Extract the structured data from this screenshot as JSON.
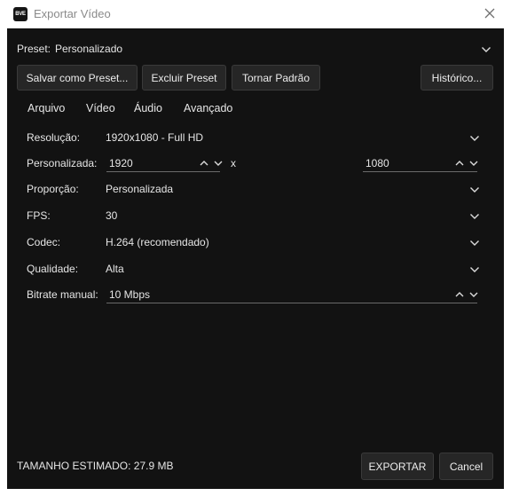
{
  "window": {
    "app_badge": "BVE",
    "title": "Exportar Vídeo"
  },
  "preset": {
    "label": "Preset:",
    "value": "Personalizado"
  },
  "toolbar": {
    "save_preset": "Salvar como Preset...",
    "delete_preset": "Excluir Preset",
    "make_default": "Tornar Padrão",
    "history": "Histórico..."
  },
  "tabs": [
    {
      "label": "Arquivo",
      "active": false
    },
    {
      "label": "Vídeo",
      "active": true
    },
    {
      "label": "Áudio",
      "active": false
    },
    {
      "label": "Avançado",
      "active": false
    }
  ],
  "video": {
    "resolution": {
      "label": "Resolução:",
      "value": "1920x1080 - Full HD"
    },
    "custom": {
      "label": "Personalizada:",
      "width": "1920",
      "separator": "x",
      "height": "1080"
    },
    "aspect": {
      "label": "Proporção:",
      "value": "Personalizada"
    },
    "fps": {
      "label": "FPS:",
      "value": "30"
    },
    "codec": {
      "label": "Codec:",
      "value": "H.264 (recomendado)"
    },
    "quality": {
      "label": "Qualidade:",
      "value": "Alta"
    },
    "bitrate": {
      "label": "Bitrate manual:",
      "value": "10 Mbps"
    }
  },
  "footer": {
    "estimated_size": "TAMANHO ESTIMADO: 27.9 MB",
    "export": "EXPORTAR",
    "cancel": "Cancel"
  },
  "icons": {
    "close": "close-icon",
    "dropdown": "chevron-down-icon",
    "increment": "chevron-up-icon"
  },
  "colors": {
    "dialog_bg": "#121212",
    "button_bg": "#262626",
    "button_border": "#3a3a3a",
    "text": "#e6e6e6",
    "titlebar_bg": "#ffffff"
  }
}
